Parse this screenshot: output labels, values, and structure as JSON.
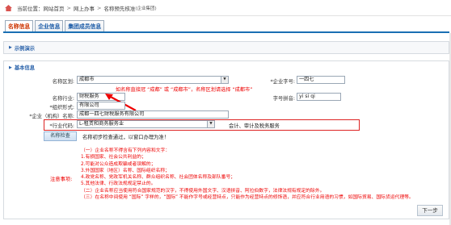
{
  "breadcrumb": {
    "prefix": "当前位置：",
    "items": [
      "网站首页",
      "网上办事",
      "名称预先核准"
    ],
    "sep": ">",
    "suffix": "(企业集团)"
  },
  "tabs": [
    {
      "label": "名称信息",
      "active": true
    },
    {
      "label": "企业信息",
      "active": false
    },
    {
      "label": "集团成员信息",
      "active": false
    }
  ],
  "sections": {
    "demo": "示例演示",
    "basic": "基本信息"
  },
  "form": {
    "region_label": "名称区划:",
    "region_value": "成都市",
    "company_field_label": "*企业字号:",
    "company_field_value": "一四七",
    "region_hint": "如名称直接冠 “成都” 或 “成都市”，名称区划请选择 “成都市”",
    "industry_label": "名称行业:",
    "industry_value": "财税服务",
    "pinyin_label": "字号拼音:",
    "pinyin_value": "yi si qi",
    "org_form_label": "*组织形式:",
    "org_form_value": "有限公司",
    "company_name_label": "*企业（机构）名称:",
    "company_name_value": "成都一四七财税服务有限公司",
    "industry_code_label": "*行业代码:",
    "industry_code_value": "L-租赁和商务服务业",
    "industry_desc": "会计、审计及税务服务",
    "check_button": "名称检查",
    "check_result": "名称初步检查通过，以窗口办理为准！",
    "notice_label": "注意事项:",
    "notice_lines": [
      "（一）企业名称不得含有下列内容和文字：",
      "1.有损国家、社会公共利益的；",
      "2.可能对公众造成欺骗或者误解的；",
      "3.外国国家（地区）名称、国际组织名称；",
      "4.政党名称、党政军机关名称、群众组织名称、社会团体名称及部队番号；",
      "5.其他法律、行政法规规定禁止的。",
      "（二）企业名称应当使用符合国家规范的汉字，不得使用外国文字、汉语拼音、阿拉伯数字，法律法规有规定的除外。",
      "（三）在名称中间使用 “国际” 字样的，“国际” 不能作字号或经营特点，只能作为经营特点的修饰语，并应符合行业用语的习惯，如国际贸易、国际货运代理等。"
    ],
    "next_button": "下一步"
  },
  "colors": {
    "accent_blue": "#1a6fb3",
    "hint_red": "#e00000",
    "active_tab_text": "#cc3300"
  }
}
